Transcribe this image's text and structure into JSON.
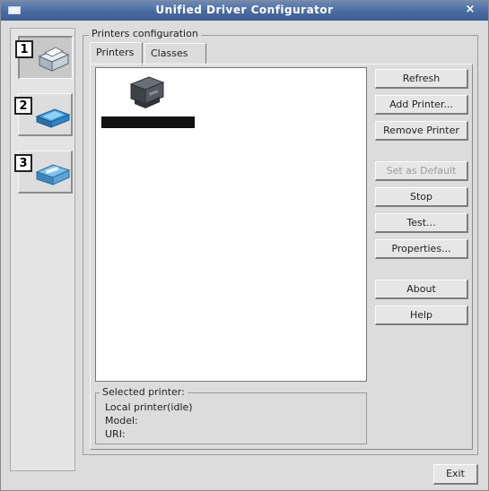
{
  "window": {
    "title": "Unified Driver Configurator",
    "close_glyph": "×"
  },
  "sidebar": {
    "items": [
      {
        "number": "1",
        "icon": "printer-config-icon",
        "active": true
      },
      {
        "number": "2",
        "icon": "scanner-config-icon",
        "active": false
      },
      {
        "number": "3",
        "icon": "port-config-icon",
        "active": false
      }
    ]
  },
  "main": {
    "group_title": "Printers configuration",
    "tabs": [
      {
        "label": "Printers",
        "active": true
      },
      {
        "label": "Classes",
        "active": false
      }
    ],
    "printer_list": [
      {
        "icon": "printer-icon",
        "name": ""
      }
    ],
    "buttons": {
      "refresh": "Refresh",
      "add_printer": "Add Printer...",
      "remove_printer": "Remove Printer",
      "set_as_default": "Set as Default",
      "stop": "Stop",
      "test": "Test...",
      "properties": "Properties...",
      "about": "About",
      "help": "Help"
    },
    "selected": {
      "title": "Selected printer:",
      "status": "Local printer(idle)",
      "model": "Model:",
      "uri": "URI:"
    }
  },
  "footer": {
    "exit": "Exit"
  },
  "colors": {
    "titlebar": "#4a6ba0",
    "panel": "#dcdcdc",
    "list_bg": "#ffffff"
  }
}
